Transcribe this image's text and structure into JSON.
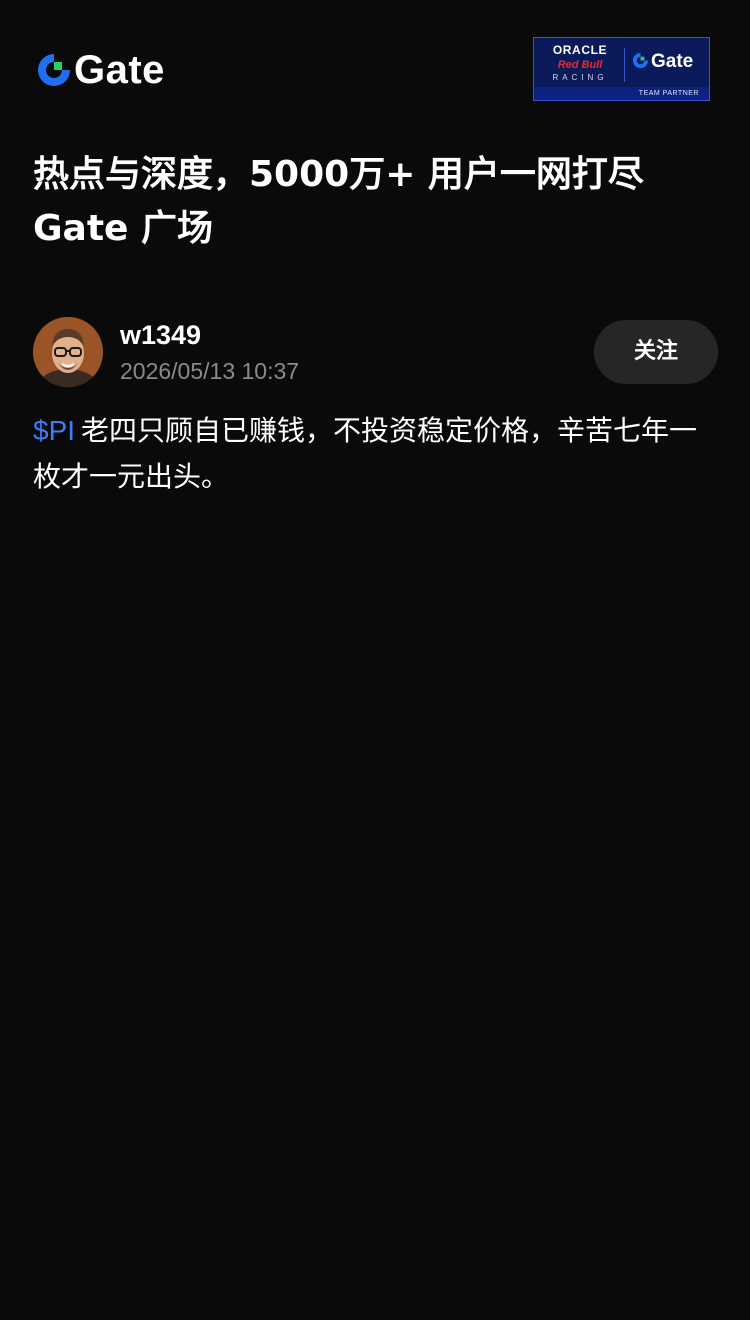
{
  "header": {
    "logo_text": "Gate",
    "logo_icon": "gate-logo-icon",
    "partner": {
      "oracle": "ORACLE",
      "redbull": "Red Bull",
      "racing": "RACING",
      "gate": "Gate",
      "team_partner": "TEAM PARTNER"
    }
  },
  "headline": {
    "line1": "热点与深度，5000万+ 用户一网打尽",
    "line2": "Gate 广场"
  },
  "post": {
    "author": "w1349",
    "timestamp": "2026/05/13 10:37",
    "follow_label": "关注",
    "ticker": "$PI",
    "text": "老四只顾自已赚钱，不投资稳定价格，辛苦七年一枚才一元出头。"
  },
  "colors": {
    "background": "#0a0a0a",
    "ticker": "#3d7cf5",
    "brand_blue": "#1f6ff5",
    "brand_green": "#1fd36a",
    "muted": "#8a8a8a",
    "button_bg": "#262626"
  }
}
